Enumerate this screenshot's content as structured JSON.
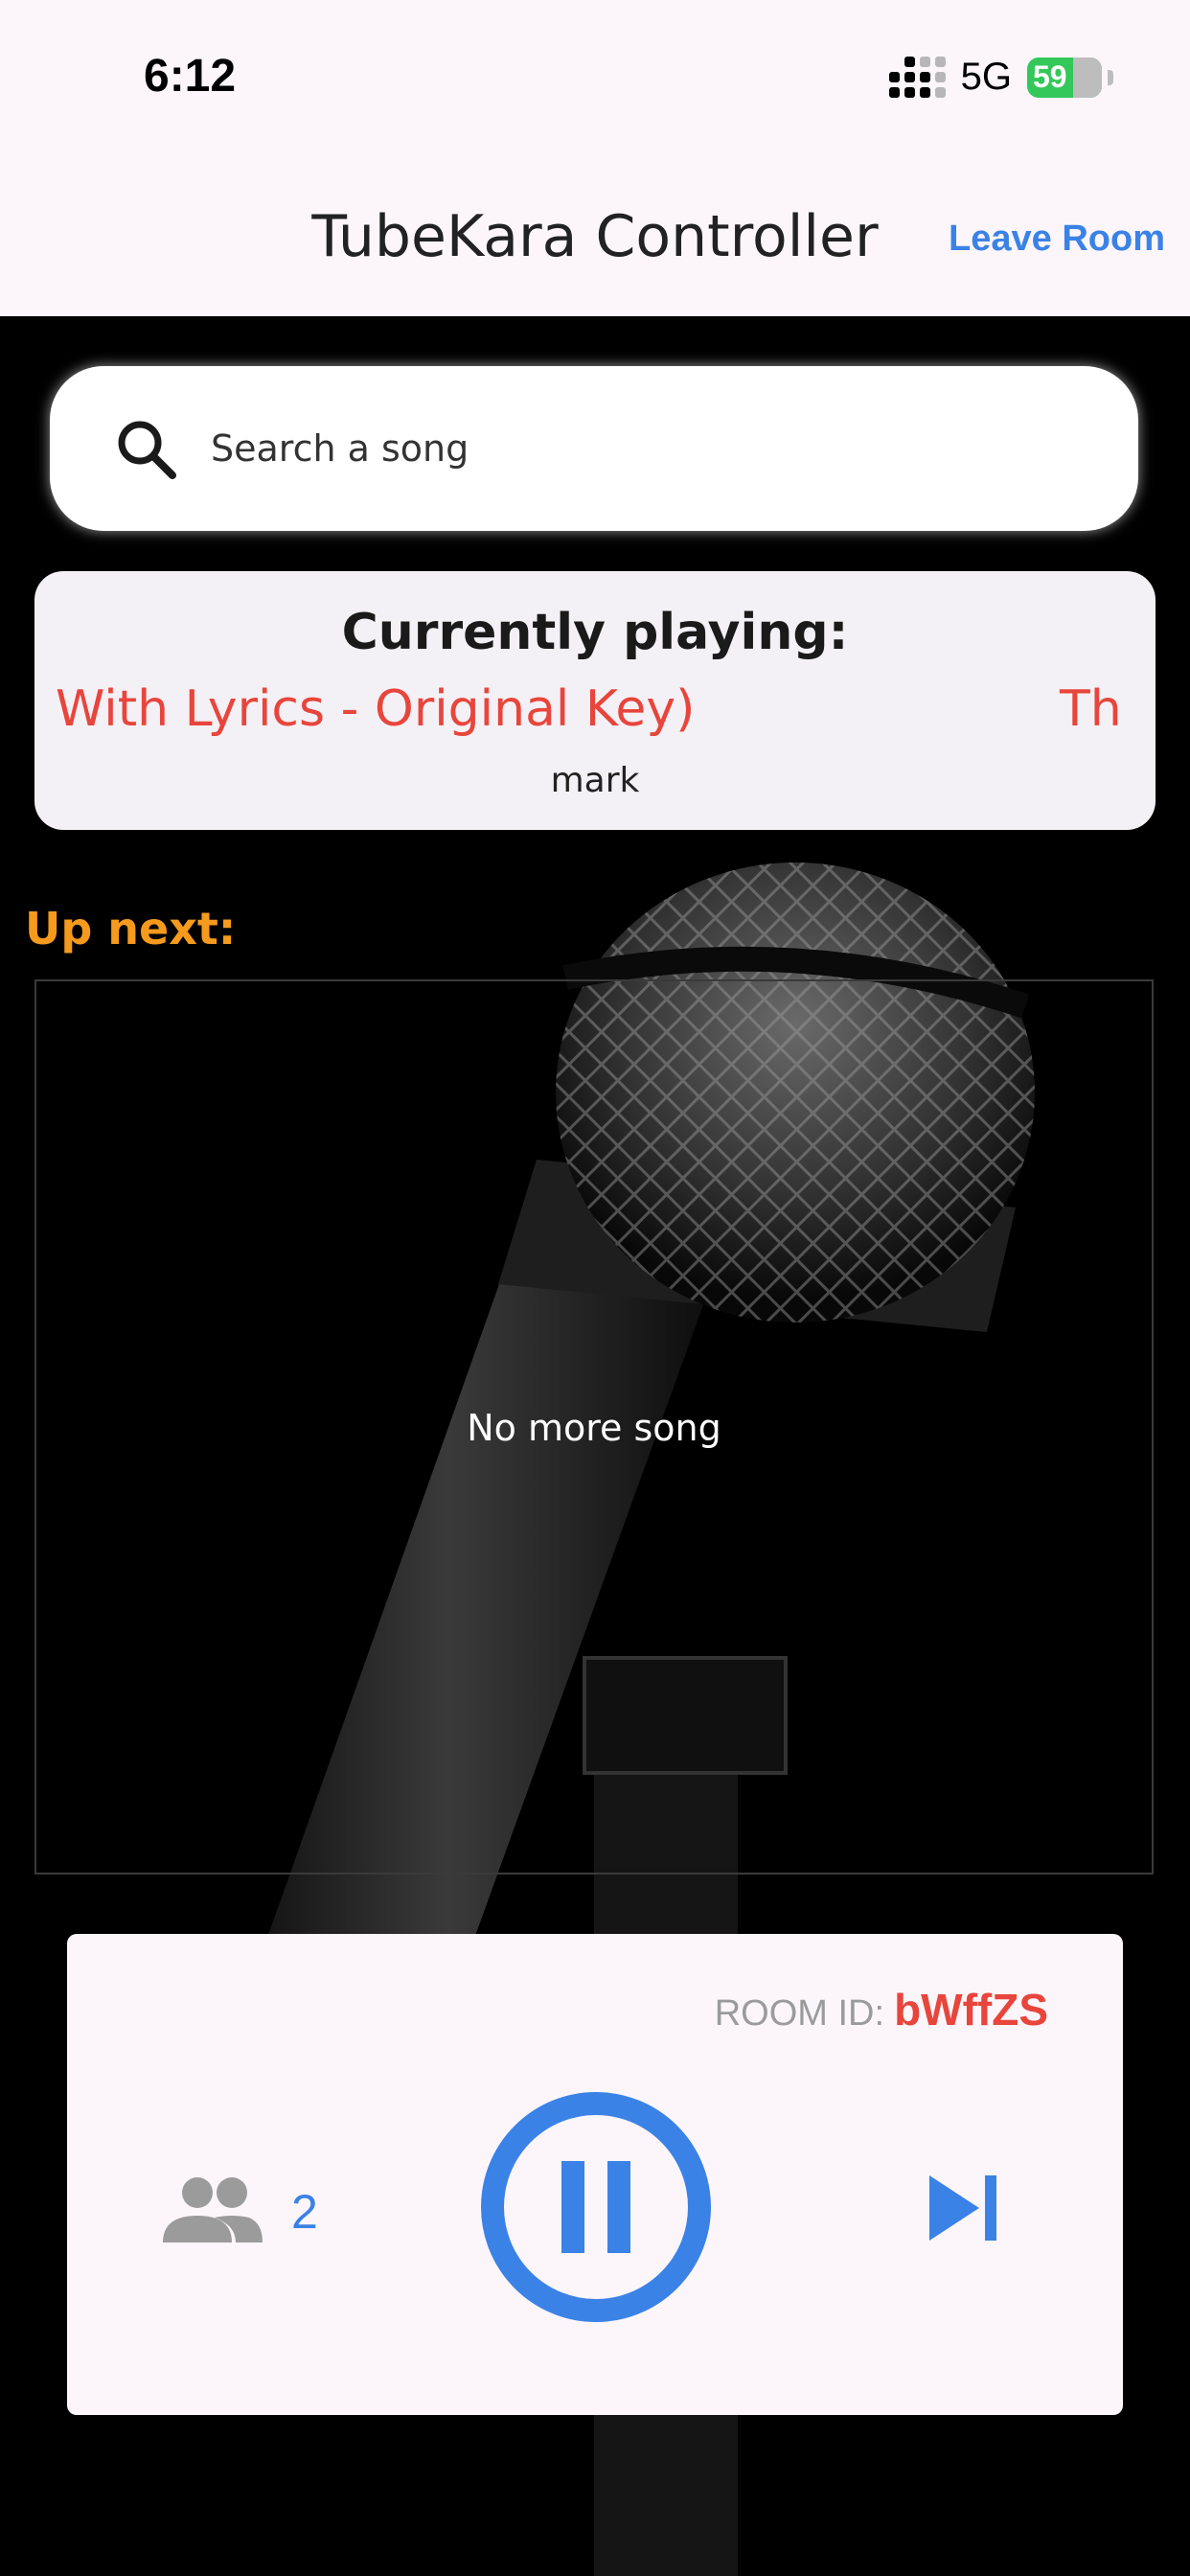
{
  "status_bar": {
    "time": "6:12",
    "network": "5G",
    "battery": "59"
  },
  "header": {
    "title": "TubeKara Controller",
    "leave_label": "Leave Room"
  },
  "search": {
    "placeholder": "Search a song",
    "icon": "search-icon"
  },
  "now_playing": {
    "heading": "Currently playing:",
    "song_fragment": "With Lyrics - Original Key)",
    "song_wrap_fragment": "Th",
    "singer": "mark"
  },
  "up_next": {
    "label": "Up next:",
    "empty_text": "No more song"
  },
  "controls": {
    "room_id_label": "ROOM ID:",
    "room_id": "bWffZS",
    "member_count": "2",
    "icons": [
      "people-icon",
      "pause-icon",
      "skip-next-icon"
    ]
  },
  "colors": {
    "accent_blue": "#3b82e6",
    "accent_red": "#e8453c",
    "accent_orange": "#f59a1c",
    "battery_green": "#34c759"
  }
}
